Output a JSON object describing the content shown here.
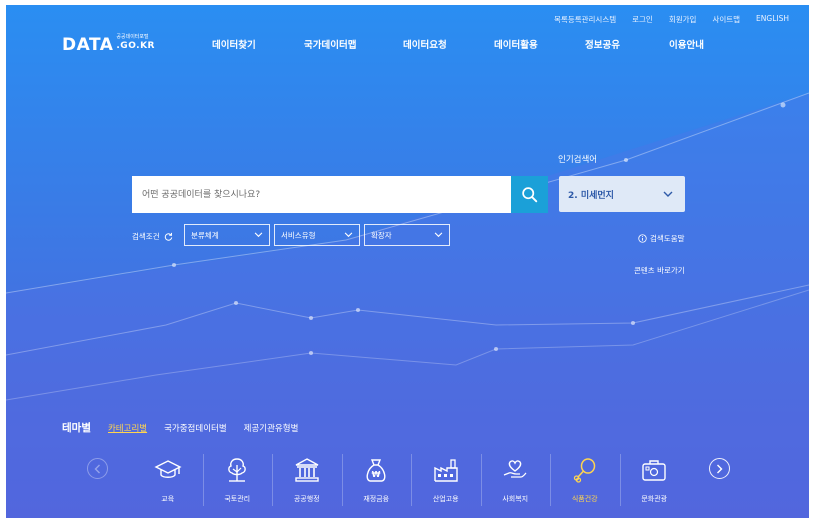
{
  "utility": [
    "목록등록관리시스템",
    "로그인",
    "회원가입",
    "사이트맵",
    "ENGLISH"
  ],
  "logo": {
    "main": "DATA",
    "sub": "공공데이터포털",
    "domain": ".GO.KR"
  },
  "gnb": [
    "데이터찾기",
    "국가데이터맵",
    "데이터요청",
    "데이터활용",
    "정보공유",
    "이용안내"
  ],
  "search": {
    "placeholder": "어떤 공공데이터를 찾으시나요?"
  },
  "popular": {
    "label": "인기검색어",
    "value": "2. 미세먼지"
  },
  "filters": {
    "condition_label": "검색조건",
    "selects": [
      "분류체계",
      "서비스유형",
      "확장자"
    ]
  },
  "help": "검색도움말",
  "contents_shortcut": "콘텐츠 바로가기",
  "tabs": {
    "title": "테마별",
    "items": [
      "카테고리별",
      "국가중점데이터별",
      "제공기관유형별"
    ],
    "active": 0
  },
  "categories": [
    {
      "label": "교육",
      "icon": "graduation-cap-icon"
    },
    {
      "label": "국토관리",
      "icon": "tree-icon"
    },
    {
      "label": "공공행정",
      "icon": "government-building-icon"
    },
    {
      "label": "재정금융",
      "icon": "money-bag-icon"
    },
    {
      "label": "산업고용",
      "icon": "factory-icon"
    },
    {
      "label": "사회복지",
      "icon": "heart-hand-icon"
    },
    {
      "label": "식품건강",
      "icon": "chicken-leg-icon"
    },
    {
      "label": "문화관광",
      "icon": "suitcase-icon"
    }
  ],
  "colors": {
    "accent_active": "#ffd54f",
    "search_button": "#1ba0d8",
    "popular_text": "#2e5aa8"
  }
}
